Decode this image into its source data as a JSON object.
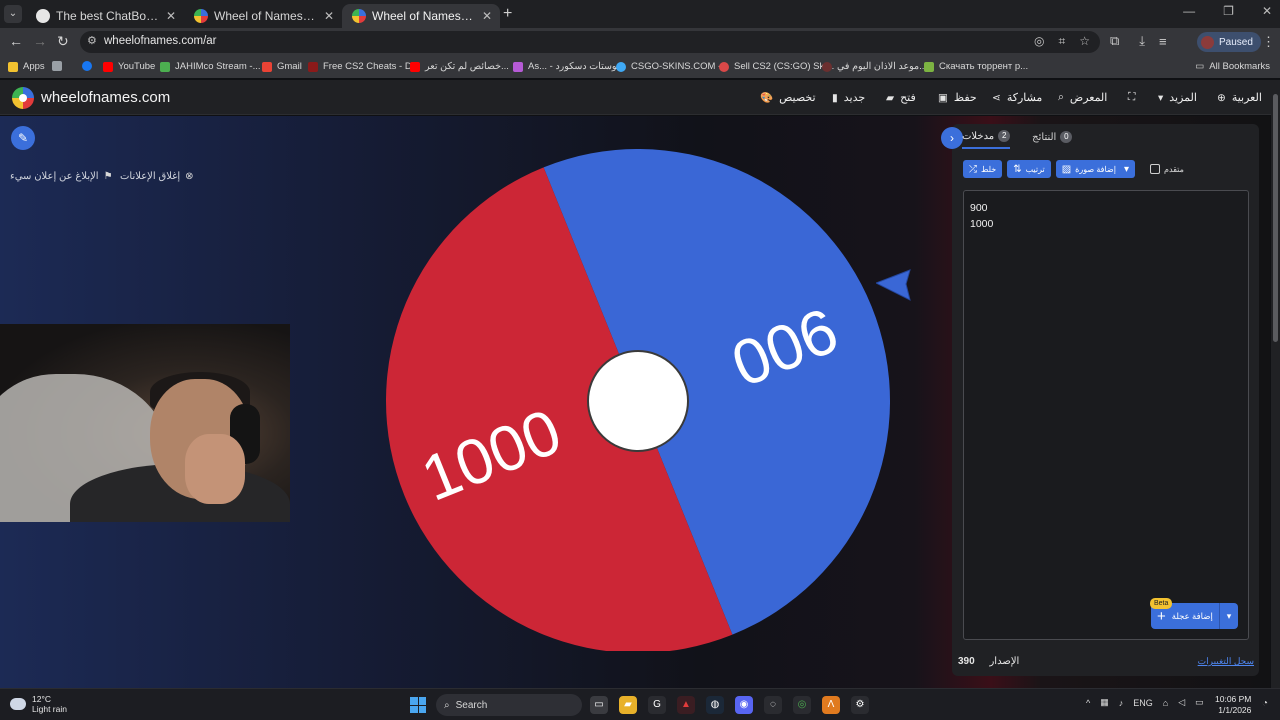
{
  "browser": {
    "tabs": [
      {
        "title": "The best ChatBot and Widgets f",
        "favicon_color": "#e6e6e6",
        "active": false
      },
      {
        "title": "Wheel of Names | اسم العشوائي",
        "favicon_color": "#e23b3b",
        "active": false
      },
      {
        "title": "Wheel of Names | اسم العشوائي",
        "favicon_color": "#e23b3b",
        "active": true
      }
    ],
    "url": "wheelofnames.com/ar",
    "profile_status": "Paused",
    "bookmarks": [
      {
        "label": "Apps",
        "color": "#f2c230"
      },
      {
        "label": "",
        "color": "#9aa0a6"
      },
      {
        "label": "",
        "color": "#1877f2"
      },
      {
        "label": "YouTube",
        "color": "#ff0000"
      },
      {
        "label": "JAHIMco Stream -...",
        "color": "#4caf50"
      },
      {
        "label": "Gmail",
        "color": "#ea4335"
      },
      {
        "label": "Free CS2 Cheats - D...",
        "color": "#8b1a1a"
      },
      {
        "label": "خصائص لم تكن تعر...",
        "color": "#ff0000"
      },
      {
        "label": "As... - بوستات دسكورد",
        "color": "#b65bd6"
      },
      {
        "label": "CSGO-SKINS.COM -...",
        "color": "#3fa9f5"
      },
      {
        "label": "Sell CS2 (CS:GO) Ski...",
        "color": "#d94848"
      },
      {
        "label": "موعد الاذان اليوم في...",
        "color": "#6b2f2f"
      },
      {
        "label": "Скачать торрент р...",
        "color": "#7cb342"
      }
    ],
    "all_bookmarks": "All Bookmarks"
  },
  "site": {
    "name": "wheelofnames.com",
    "menu": [
      {
        "label": "العربية",
        "icon": "globe-icon"
      },
      {
        "label": "المزيد",
        "icon": "caret-down-icon"
      },
      {
        "label": "",
        "icon": "fullscreen-icon"
      },
      {
        "label": "المعرض",
        "icon": "search-icon"
      },
      {
        "label": "مشاركة",
        "icon": "share-icon"
      },
      {
        "label": "حفظ",
        "icon": "save-icon"
      },
      {
        "label": "فتح",
        "icon": "folder-icon"
      },
      {
        "label": "جديد",
        "icon": "file-icon"
      },
      {
        "label": "تخصيص",
        "icon": "palette-icon"
      }
    ]
  },
  "main": {
    "close_ads": "إغلاق الإعلانات",
    "report_ad": "الإبلاغ عن إعلان سيء"
  },
  "wheel": {
    "colors": {
      "red": "#cc2636",
      "blue": "#3a67d6",
      "hub": "#ffffff",
      "pointer": "#3a67d6"
    }
  },
  "chart_data": {
    "type": "pie",
    "categories": [
      "900",
      "1000"
    ],
    "values": [
      1,
      1
    ]
  },
  "panel": {
    "tabs": [
      {
        "label": "مدخلات",
        "count": "2",
        "active": true
      },
      {
        "label": "النتائج",
        "count": "0",
        "active": false
      }
    ],
    "buttons": {
      "shuffle": "خلط",
      "sort": "ترتيب",
      "add_image": "إضافة صورة",
      "advanced": "متقدم"
    },
    "entries": [
      "900",
      "1000"
    ],
    "add_wheel": "إضافة عجلة",
    "beta": "Beta",
    "version_label": "الإصدار",
    "version_number": "390",
    "changelog": "سجل التغييرات"
  },
  "taskbar": {
    "temperature": "12°C",
    "condition": "Light rain",
    "search": "Search",
    "language": "ENG",
    "time": "10:06 PM",
    "date": "1/1/2026"
  }
}
